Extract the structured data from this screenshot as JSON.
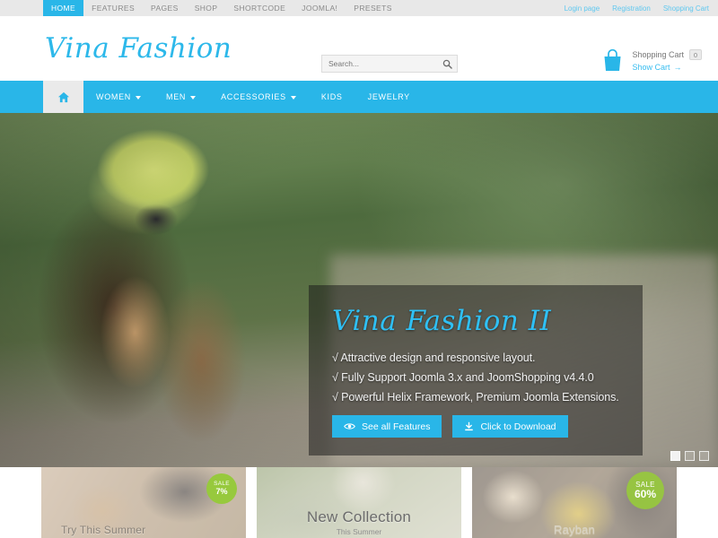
{
  "topbar": {
    "nav": [
      {
        "label": "HOME",
        "active": true
      },
      {
        "label": "FEATURES",
        "active": false
      },
      {
        "label": "PAGES",
        "active": false
      },
      {
        "label": "SHOP",
        "active": false
      },
      {
        "label": "SHORTCODE",
        "active": false
      },
      {
        "label": "JOOMLA!",
        "active": false
      },
      {
        "label": "PRESETS",
        "active": false
      }
    ],
    "links": [
      {
        "label": "Login page"
      },
      {
        "label": "Registration"
      },
      {
        "label": "Shopping Cart"
      }
    ]
  },
  "header": {
    "logo": "Vina Fashion",
    "search": {
      "placeholder": "Search...",
      "value": "",
      "icon": "search-icon"
    },
    "cart": {
      "icon": "shopping-bag-icon",
      "label": "Shopping Cart",
      "count": "0",
      "show_cart": "Show Cart",
      "arrow": "→"
    }
  },
  "mainnav": {
    "home_icon": "home-icon",
    "items": [
      {
        "label": "WOMEN",
        "caret": true
      },
      {
        "label": "MEN",
        "caret": true
      },
      {
        "label": "ACCESSORIES",
        "caret": true
      },
      {
        "label": "KIDS",
        "caret": false
      },
      {
        "label": "JEWELRY",
        "caret": false
      }
    ]
  },
  "hero": {
    "title": "Vina Fashion II",
    "bullets": [
      "√ Attractive design and responsive layout.",
      "√ Fully Support Joomla 3.x and JoomShopping v4.4.0",
      "√ Powerful Helix Framework, Premium Joomla Extensions."
    ],
    "buttons": [
      {
        "label": "See all Features",
        "icon": "eye-icon"
      },
      {
        "label": "Click to Download",
        "icon": "download-icon"
      }
    ],
    "slides": [
      {
        "active": true
      },
      {
        "active": false
      },
      {
        "active": false
      }
    ]
  },
  "promos": [
    {
      "title": "Try This Summer",
      "subtitle": "",
      "badge_line1": "SALE",
      "badge_line2": "7%",
      "has_badge": true
    },
    {
      "title": "New Collection",
      "subtitle": "This Summer",
      "badge_line1": "",
      "badge_line2": "",
      "has_badge": false
    },
    {
      "title": "Rayban",
      "subtitle": "",
      "badge_line1": "SALE",
      "badge_line2": "60%",
      "has_badge": true
    }
  ],
  "colors": {
    "accent": "#29b6e8",
    "topbar_bg": "#e8e8e8",
    "badge_green": "#97c93d",
    "hero_title": "#2fc0f5"
  }
}
